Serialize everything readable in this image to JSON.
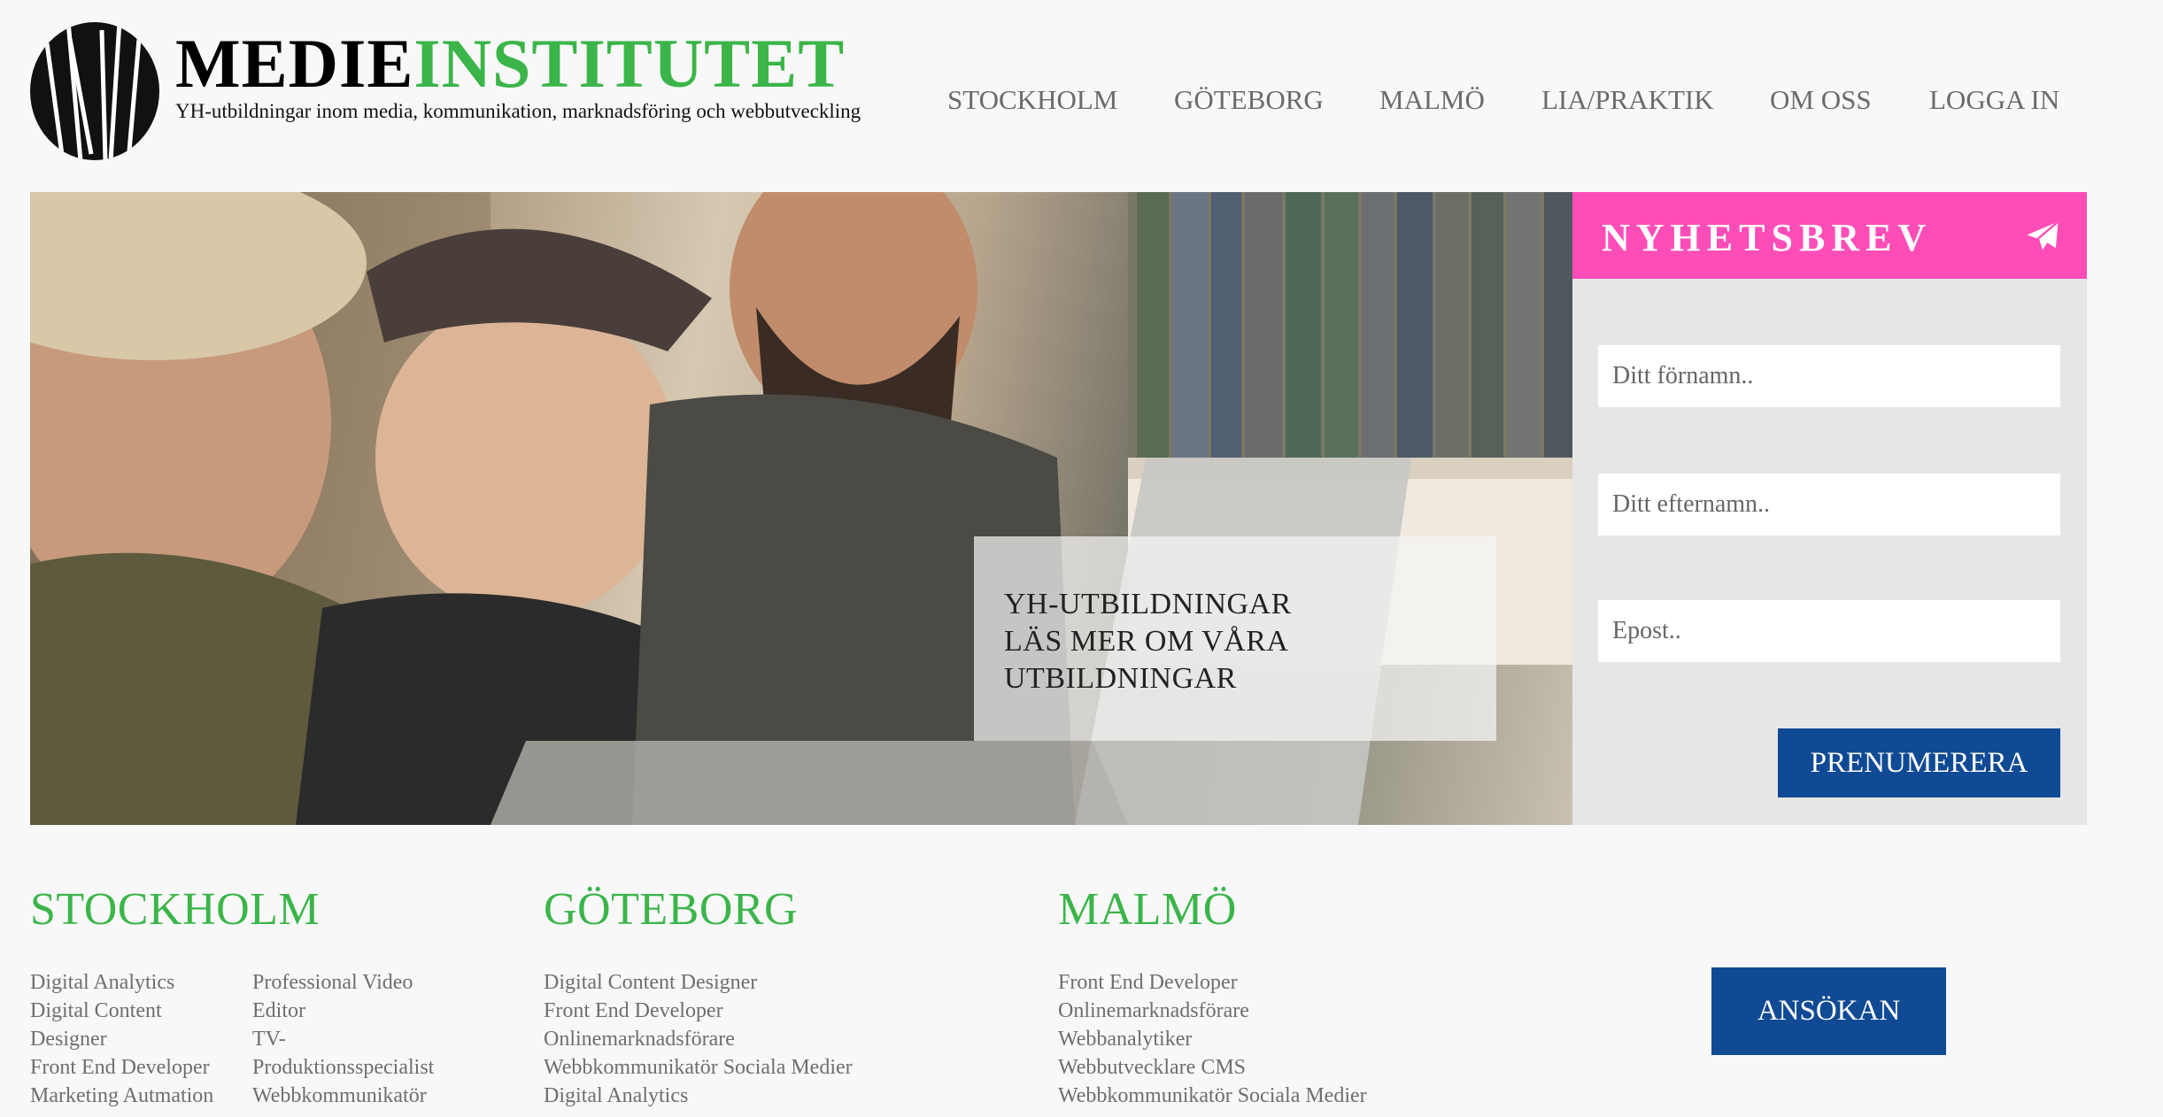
{
  "brand": {
    "name_part1": "MEDIE",
    "name_part2": "INSTITUTET",
    "tagline": "YH-utbildningar inom media, kommunikation, marknadsföring och webbutveckling"
  },
  "nav": [
    "STOCKHOLM",
    "GÖTEBORG",
    "MALMÖ",
    "LIA/PRAKTIK",
    "OM OSS",
    "LOGGA IN"
  ],
  "hero": {
    "caption_lines": [
      "YH-UTBILDNINGAR",
      "LÄS MER OM VÅRA",
      "UTBILDNINGAR"
    ]
  },
  "newsletter": {
    "title": "NYHETSBREV",
    "icon": "paper-plane-icon",
    "firstname_placeholder": "Ditt förnamn..",
    "lastname_placeholder": "Ditt efternamn..",
    "email_placeholder": "Epost..",
    "submit_label": "PRENUMERERA"
  },
  "cities": {
    "stockholm": {
      "heading": "STOCKHOLM",
      "col1": [
        "Digital Analytics",
        "Digital Content",
        "Designer",
        "Front End Developer",
        "Marketing Autmation"
      ],
      "col2": [
        "Professional Video",
        "Editor",
        "TV-",
        "Produktionsspecialist",
        "Webbkommunikatör"
      ]
    },
    "goteborg": {
      "heading": "GÖTEBORG",
      "courses": [
        "Digital Content Designer",
        "Front End Developer",
        "Onlinemarknadsförare",
        "Webbkommunikatör Sociala Medier",
        "Digital Analytics"
      ]
    },
    "malmo": {
      "heading": "MALMÖ",
      "courses": [
        "Front End Developer",
        "Onlinemarknadsförare",
        "Webbanalytiker",
        "Webbutvecklare CMS",
        "Webbkommunikatör Sociala Medier"
      ]
    }
  },
  "apply_label": "ANSÖKAN",
  "colors": {
    "brand_green": "#3bb54a",
    "newsletter_pink": "#ff4db8",
    "button_blue": "#104a94"
  }
}
